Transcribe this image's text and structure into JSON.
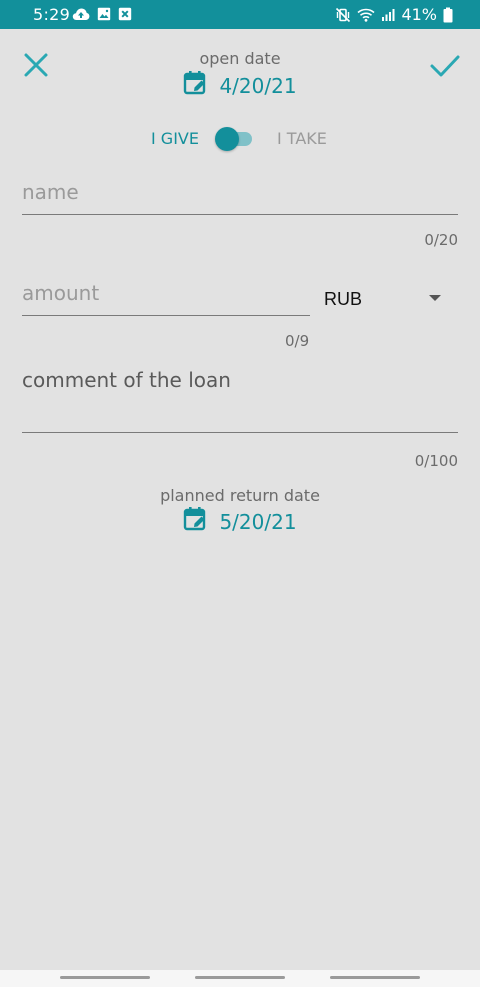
{
  "status_bar": {
    "time": "5:29",
    "battery": "41%",
    "left_icons": [
      "cloud-upload-icon",
      "image-icon",
      "close-box-icon"
    ],
    "right_icons": [
      "mute-vibrate-icon",
      "wifi-icon",
      "signal-icon",
      "battery-icon"
    ]
  },
  "header": {
    "close_icon": "close-icon",
    "confirm_icon": "check-icon",
    "open_date_label": "open date",
    "open_date": "4/20/21"
  },
  "toggle": {
    "give_label": "I GIVE",
    "take_label": "I TAKE",
    "selected": "I GIVE"
  },
  "form": {
    "name": {
      "value": "",
      "placeholder": "name",
      "counter": "0/20"
    },
    "amount": {
      "value": "",
      "placeholder": "amount",
      "counter": "0/9"
    },
    "currency": {
      "value": "RUB"
    },
    "comment": {
      "value": "",
      "placeholder": "comment of the loan",
      "counter": "0/100"
    }
  },
  "return_date": {
    "label": "planned return date",
    "date": "5/20/21"
  },
  "colors": {
    "accent": "#138f9b",
    "status_bar": "#12909b",
    "background": "#e2e2e2"
  }
}
